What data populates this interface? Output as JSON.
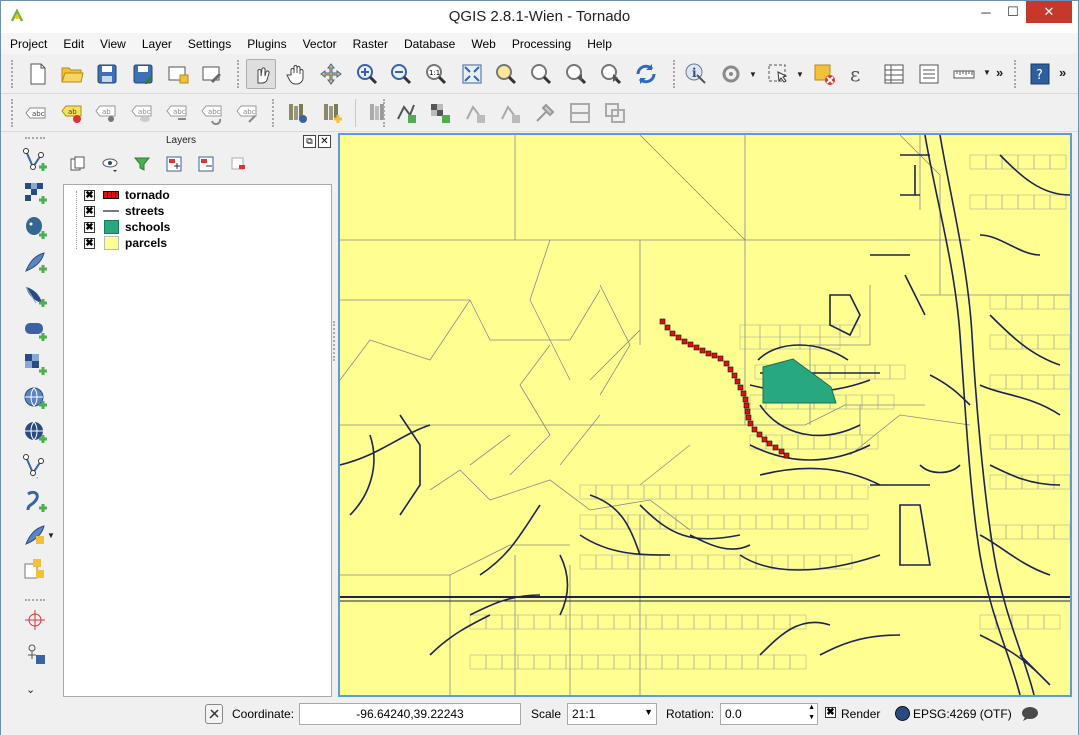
{
  "window": {
    "title": "QGIS 2.8.1-Wien - Tornado",
    "minimize": "─",
    "maximize": "☐",
    "close": "✕"
  },
  "menu": [
    "Project",
    "Edit",
    "View",
    "Layer",
    "Settings",
    "Plugins",
    "Vector",
    "Raster",
    "Database",
    "Web",
    "Processing",
    "Help"
  ],
  "toolbar": {
    "overflow_label": "»"
  },
  "layers_panel": {
    "title": "Layers",
    "float_label": "⧉",
    "close_label": "✕",
    "layers": [
      {
        "name": "tornado",
        "checked": "✖",
        "symbol": "red-square-line"
      },
      {
        "name": "streets",
        "checked": "✖",
        "symbol": "line"
      },
      {
        "name": "schools",
        "checked": "✖",
        "symbol": "polygon-green"
      },
      {
        "name": "parcels",
        "checked": "✖",
        "symbol": "polygon-yellow"
      }
    ]
  },
  "left_toolbar": {
    "more_label": "»"
  },
  "statusbar": {
    "coordinate_label": "Coordinate:",
    "coordinate_value": "-96.64240,39.22243",
    "scale_label": "Scale",
    "scale_value": "21:1",
    "rotation_label": "Rotation:",
    "rotation_value": "0.0",
    "render_label": "Render",
    "render_checked": "✖",
    "crs_label": "EPSG:4269 (OTF)"
  },
  "colors": {
    "parcels": "#ffff91",
    "schools": "#27a880",
    "tornado": "#e0100f",
    "streets": "#2a2f5a",
    "map_border": "#5b9be0"
  }
}
